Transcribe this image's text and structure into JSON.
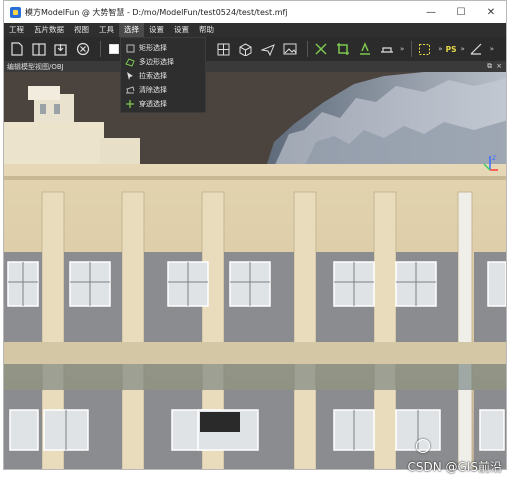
{
  "window": {
    "title": "模方ModelFun @ 大势智慧 - D:/mo/ModelFun/test0524/test/test.mfj",
    "controls": {
      "minimize": "—",
      "maximize": "☐",
      "close": "✕"
    }
  },
  "menubar": {
    "items": [
      {
        "label": "工程"
      },
      {
        "label": "瓦片数据"
      },
      {
        "label": "视图"
      },
      {
        "label": "工具"
      },
      {
        "label": "选择",
        "active": true
      },
      {
        "label": "设置"
      },
      {
        "label": "设置"
      },
      {
        "label": "帮助"
      }
    ]
  },
  "toolbar": {
    "ps_label": "PS",
    "more": "»"
  },
  "panel": {
    "title": "编辑模型视图/OBJ",
    "restore": "⧉",
    "close": "×"
  },
  "select_menu": {
    "items": [
      {
        "label": "矩形选择",
        "icon": "rectangle-select-icon"
      },
      {
        "label": "多边形选择",
        "icon": "polygon-select-icon"
      },
      {
        "label": "拉索选择",
        "icon": "lasso-select-icon"
      },
      {
        "label": "清除选择",
        "icon": "clear-select-icon"
      },
      {
        "label": "穿透选择",
        "icon": "penetrate-select-icon"
      }
    ]
  },
  "viewport": {
    "axis_label": "Z"
  },
  "watermark": {
    "text": "CSDN @GIS前沿"
  },
  "colors": {
    "menubar": "#2f2f2f",
    "toolbar": "#2b2b2b",
    "ps": "#e6d94a",
    "accent_green": "#7ec850"
  }
}
